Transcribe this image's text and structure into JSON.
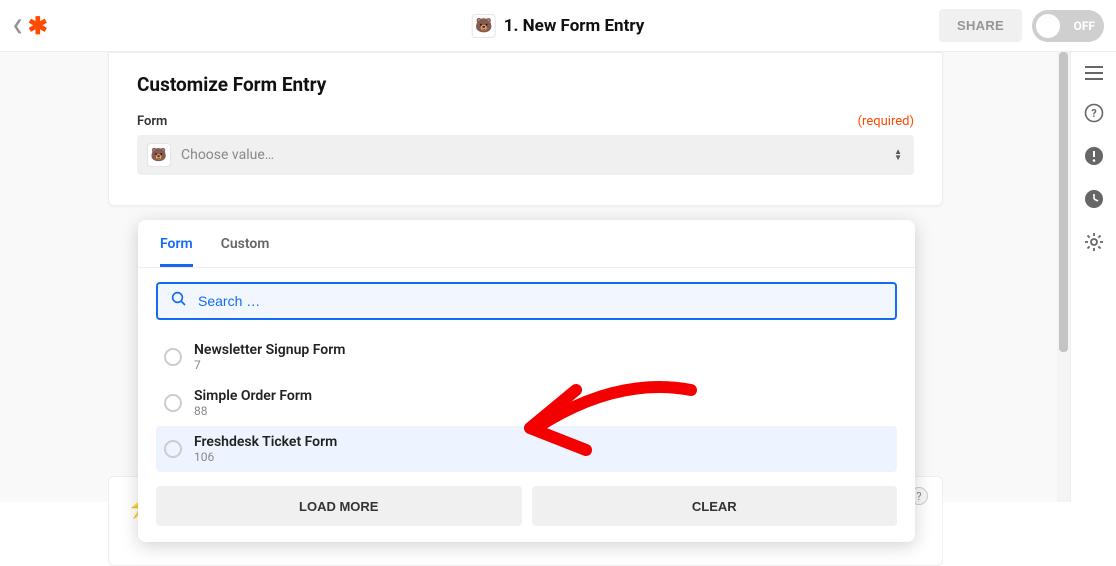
{
  "topbar": {
    "title": "1. New Form Entry",
    "share_label": "SHARE",
    "toggle_label": "OFF"
  },
  "card": {
    "title": "Customize Form Entry",
    "field_label": "Form",
    "required_label": "(required)",
    "select_placeholder": "Choose value…"
  },
  "dropdown": {
    "tabs": {
      "form": "Form",
      "custom": "Custom"
    },
    "search_placeholder": "Search …",
    "options": [
      {
        "title": "Newsletter Signup Form",
        "sub": "7"
      },
      {
        "title": "Simple Order Form",
        "sub": "88"
      },
      {
        "title": "Freshdesk Ticket Form",
        "sub": "106"
      }
    ],
    "load_more": "LOAD MORE",
    "clear": "CLEAR"
  },
  "help_dot": "?"
}
